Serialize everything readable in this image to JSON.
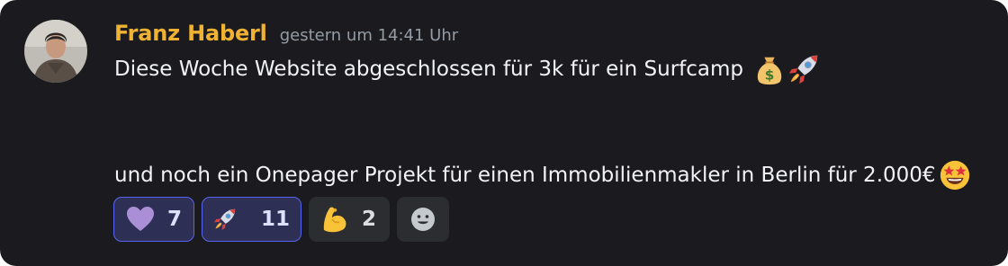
{
  "message": {
    "author": "Franz Haberl",
    "timestamp": "gestern um 14:41 Uhr",
    "line1": "Diese Woche Website abgeschlossen für 3k für ein Surfcamp",
    "line1_emojis": [
      "money-bag-icon",
      "rocket-icon"
    ],
    "line2": "und noch ein Onepager Projekt für einen Immobilienmakler in Berlin für 2.000€",
    "line2_emojis": [
      "star-struck-icon"
    ]
  },
  "reactions": [
    {
      "icon": "purple-heart-icon",
      "count": "7",
      "active": true
    },
    {
      "icon": "rocket-icon",
      "count": "11",
      "active": true
    },
    {
      "icon": "flexed-biceps-icon",
      "count": "2",
      "active": false
    }
  ],
  "colors": {
    "background": "#1b1b1f",
    "username": "#f0b232",
    "timestamp": "#949ba4",
    "text": "#f2f3f5",
    "reaction_active_bg": "#2d3054",
    "reaction_active_border": "#5865f2",
    "reaction_bg": "#2b2d31"
  }
}
